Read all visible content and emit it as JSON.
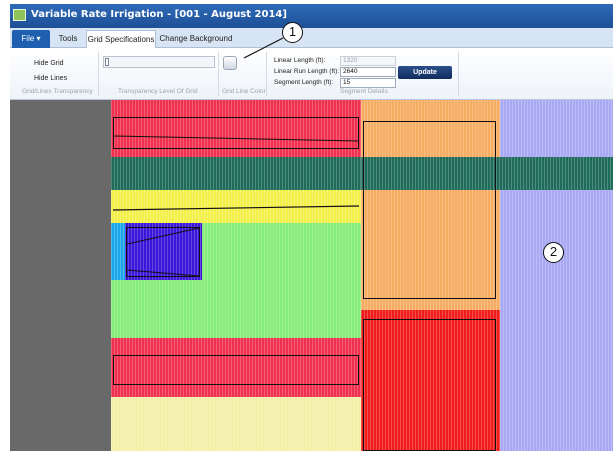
{
  "window": {
    "title": "Variable Rate Irrigation - [001 - August 2014]"
  },
  "tabs": {
    "file": "File",
    "tools": "Tools",
    "grid_specifications": "Grid Specifications",
    "change_background": "Change Background"
  },
  "ribbon": {
    "hide_grid": "Hide Grid",
    "hide_lines": "Hide Lines",
    "group_grid_lines_transparency": "Grid/Lines Transparency",
    "group_transparency_level": "Transparency Level Of Grid",
    "group_grid_line_color": "Grid Line Color",
    "linear_length_label": "Linear Length (ft):",
    "linear_length_value": "1320",
    "linear_run_length_label": "Linear Run Length (ft):",
    "linear_run_length_value": "2640",
    "segment_length_label": "Segment Length (ft):",
    "segment_length_value": "15",
    "update_label": "Update",
    "group_segment_details": "Segment Details"
  },
  "callouts": {
    "one": "1",
    "two": "2"
  },
  "colors": {
    "red": "#f0304f",
    "teal": "#1e6b5a",
    "yellow": "#f4f04a",
    "green": "#86ec7a",
    "blue": "#3a16d8",
    "cyan": "#1aa6e8",
    "light_yellow": "#f4f0a8",
    "orange": "#f6ac62",
    "bright_red": "#f01c1c",
    "lavender": "#a8a8f4"
  }
}
